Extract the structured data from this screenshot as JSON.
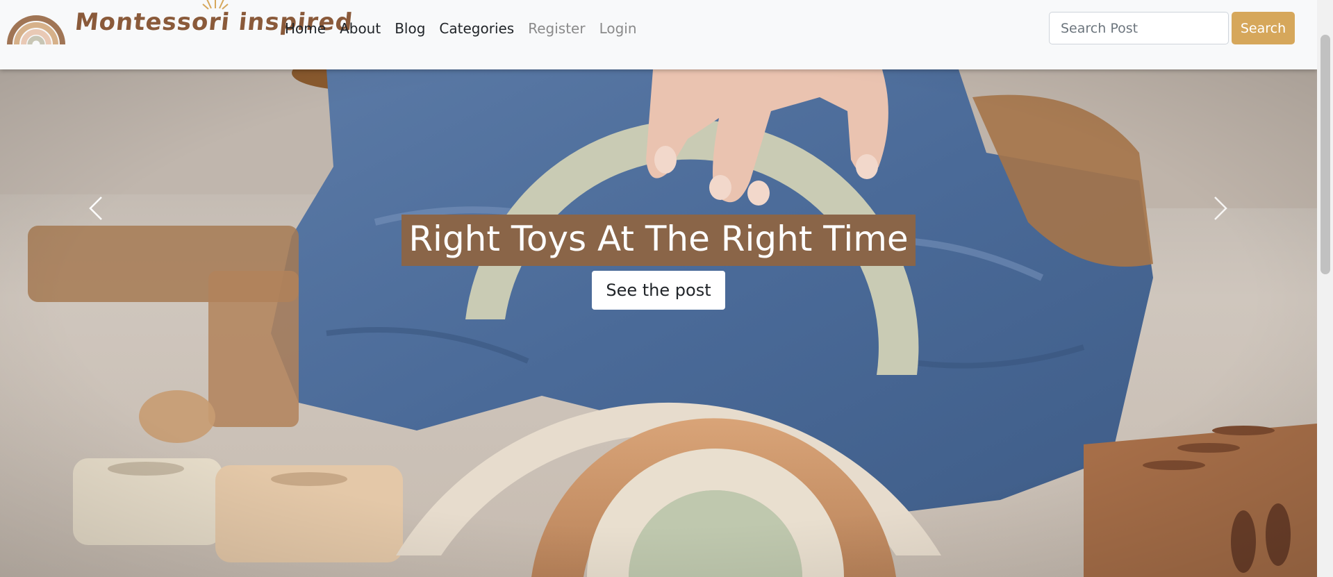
{
  "brand": {
    "name": "Montessori inspired",
    "color": "#8a5a3a"
  },
  "nav": {
    "links": [
      "Home",
      "About",
      "Blog",
      "Categories"
    ],
    "auth_links": [
      "Register",
      "Login"
    ]
  },
  "search": {
    "placeholder": "Search Post",
    "button_label": "Search",
    "button_color": "#d6a75b"
  },
  "carousel": {
    "caption_title": "Right Toys At The Right Time",
    "caption_bg": "#8a6548",
    "cta_label": "See the post",
    "prev_icon": "chevron-left-icon",
    "next_icon": "chevron-right-icon"
  }
}
